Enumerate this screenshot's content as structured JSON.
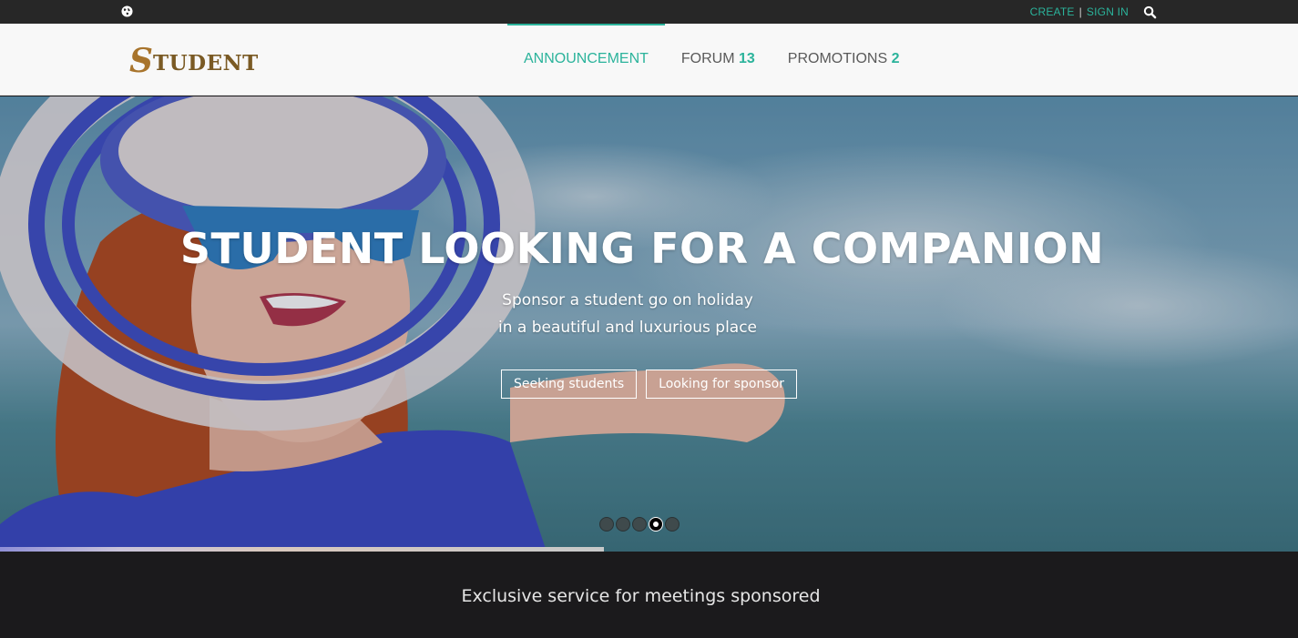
{
  "topbar": {
    "globe_icon": "globe-icon",
    "create_label": "CREATE",
    "separator": "|",
    "signin_label": "SIGN IN",
    "search_icon": "search-icon"
  },
  "header": {
    "logo_initial": "S",
    "logo_rest": "TUDENT",
    "nav": [
      {
        "label": "ANNOUNCEMENT",
        "count": ""
      },
      {
        "label": "FORUM",
        "count": "13"
      },
      {
        "label": "PROMOTIONS",
        "count": "2"
      }
    ]
  },
  "hero": {
    "title": "STUDENT LOOKING FOR A COMPANION",
    "subtitle_line1": "Sponsor a student go on holiday",
    "subtitle_line2": "in a beautiful and luxurious place",
    "button_seeking": "Seeking students",
    "button_looking": "Looking for sponsor",
    "slides_total": 5,
    "active_slide": 4,
    "autoplay_progress": 0.465
  },
  "strip": {
    "text": "Exclusive service for meetings sponsored"
  },
  "colors": {
    "accent": "#2bb39b",
    "topbar_bg": "#272727",
    "header_bg": "#f8f8f8",
    "footer_bg": "#1b1a1c"
  }
}
